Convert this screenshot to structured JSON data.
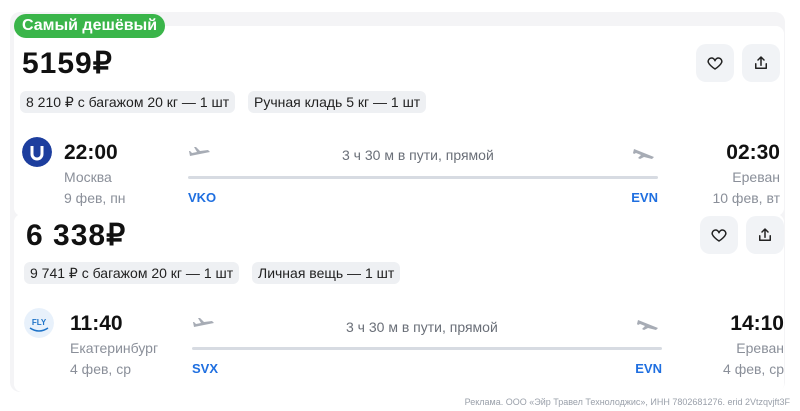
{
  "badge": "Самый дешёвый",
  "offers": [
    {
      "price": "5159₽",
      "chips": [
        "8 210 ₽ с багажом 20 кг — 1 шт",
        "Ручная кладь 5 кг — 1 шт"
      ],
      "depart_time": "22:00",
      "depart_city": "Москва",
      "depart_date": "9 фев, пн",
      "depart_code": "VKO",
      "duration": "3 ч 30 м в пути, прямой",
      "arrive_time": "02:30",
      "arrive_city": "Ереван",
      "arrive_date": "10 фев, вт",
      "arrive_code": "EVN"
    },
    {
      "price": "6 338₽",
      "chips": [
        "9 741 ₽ с багажом 20 кг — 1 шт",
        "Личная вещь — 1 шт"
      ],
      "depart_time": "11:40",
      "depart_city": "Екатеринбург",
      "depart_date": "4 фев, ср",
      "depart_code": "SVX",
      "duration": "3 ч 30 м в пути, прямой",
      "arrive_time": "14:10",
      "arrive_city": "Ереван",
      "arrive_date": "4 фев, ср",
      "arrive_code": "EVN"
    }
  ],
  "logos": {
    "airline2": "FLY"
  },
  "footer": "Реклама. ООО «Эйр Травел Технолоджис», ИНН 7802681276. erid 2Vtzqvjft3F",
  "icons": {
    "favorite": "heart-icon",
    "share": "share-icon"
  },
  "colors": {
    "badge": "#3ab54a",
    "code": "#1f6fe0"
  }
}
